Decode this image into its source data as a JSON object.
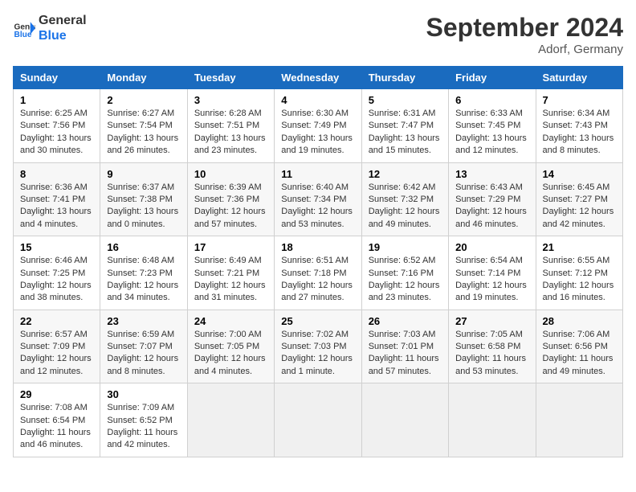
{
  "header": {
    "logo_line1": "General",
    "logo_line2": "Blue",
    "month": "September 2024",
    "location": "Adorf, Germany"
  },
  "weekdays": [
    "Sunday",
    "Monday",
    "Tuesday",
    "Wednesday",
    "Thursday",
    "Friday",
    "Saturday"
  ],
  "weeks": [
    [
      {
        "day": "1",
        "sunrise": "6:25 AM",
        "sunset": "7:56 PM",
        "daylight": "13 hours and 30 minutes."
      },
      {
        "day": "2",
        "sunrise": "6:27 AM",
        "sunset": "7:54 PM",
        "daylight": "13 hours and 26 minutes."
      },
      {
        "day": "3",
        "sunrise": "6:28 AM",
        "sunset": "7:51 PM",
        "daylight": "13 hours and 23 minutes."
      },
      {
        "day": "4",
        "sunrise": "6:30 AM",
        "sunset": "7:49 PM",
        "daylight": "13 hours and 19 minutes."
      },
      {
        "day": "5",
        "sunrise": "6:31 AM",
        "sunset": "7:47 PM",
        "daylight": "13 hours and 15 minutes."
      },
      {
        "day": "6",
        "sunrise": "6:33 AM",
        "sunset": "7:45 PM",
        "daylight": "13 hours and 12 minutes."
      },
      {
        "day": "7",
        "sunrise": "6:34 AM",
        "sunset": "7:43 PM",
        "daylight": "13 hours and 8 minutes."
      }
    ],
    [
      {
        "day": "8",
        "sunrise": "6:36 AM",
        "sunset": "7:41 PM",
        "daylight": "13 hours and 4 minutes."
      },
      {
        "day": "9",
        "sunrise": "6:37 AM",
        "sunset": "7:38 PM",
        "daylight": "13 hours and 0 minutes."
      },
      {
        "day": "10",
        "sunrise": "6:39 AM",
        "sunset": "7:36 PM",
        "daylight": "12 hours and 57 minutes."
      },
      {
        "day": "11",
        "sunrise": "6:40 AM",
        "sunset": "7:34 PM",
        "daylight": "12 hours and 53 minutes."
      },
      {
        "day": "12",
        "sunrise": "6:42 AM",
        "sunset": "7:32 PM",
        "daylight": "12 hours and 49 minutes."
      },
      {
        "day": "13",
        "sunrise": "6:43 AM",
        "sunset": "7:29 PM",
        "daylight": "12 hours and 46 minutes."
      },
      {
        "day": "14",
        "sunrise": "6:45 AM",
        "sunset": "7:27 PM",
        "daylight": "12 hours and 42 minutes."
      }
    ],
    [
      {
        "day": "15",
        "sunrise": "6:46 AM",
        "sunset": "7:25 PM",
        "daylight": "12 hours and 38 minutes."
      },
      {
        "day": "16",
        "sunrise": "6:48 AM",
        "sunset": "7:23 PM",
        "daylight": "12 hours and 34 minutes."
      },
      {
        "day": "17",
        "sunrise": "6:49 AM",
        "sunset": "7:21 PM",
        "daylight": "12 hours and 31 minutes."
      },
      {
        "day": "18",
        "sunrise": "6:51 AM",
        "sunset": "7:18 PM",
        "daylight": "12 hours and 27 minutes."
      },
      {
        "day": "19",
        "sunrise": "6:52 AM",
        "sunset": "7:16 PM",
        "daylight": "12 hours and 23 minutes."
      },
      {
        "day": "20",
        "sunrise": "6:54 AM",
        "sunset": "7:14 PM",
        "daylight": "12 hours and 19 minutes."
      },
      {
        "day": "21",
        "sunrise": "6:55 AM",
        "sunset": "7:12 PM",
        "daylight": "12 hours and 16 minutes."
      }
    ],
    [
      {
        "day": "22",
        "sunrise": "6:57 AM",
        "sunset": "7:09 PM",
        "daylight": "12 hours and 12 minutes."
      },
      {
        "day": "23",
        "sunrise": "6:59 AM",
        "sunset": "7:07 PM",
        "daylight": "12 hours and 8 minutes."
      },
      {
        "day": "24",
        "sunrise": "7:00 AM",
        "sunset": "7:05 PM",
        "daylight": "12 hours and 4 minutes."
      },
      {
        "day": "25",
        "sunrise": "7:02 AM",
        "sunset": "7:03 PM",
        "daylight": "12 hours and 1 minute."
      },
      {
        "day": "26",
        "sunrise": "7:03 AM",
        "sunset": "7:01 PM",
        "daylight": "11 hours and 57 minutes."
      },
      {
        "day": "27",
        "sunrise": "7:05 AM",
        "sunset": "6:58 PM",
        "daylight": "11 hours and 53 minutes."
      },
      {
        "day": "28",
        "sunrise": "7:06 AM",
        "sunset": "6:56 PM",
        "daylight": "11 hours and 49 minutes."
      }
    ],
    [
      {
        "day": "29",
        "sunrise": "7:08 AM",
        "sunset": "6:54 PM",
        "daylight": "11 hours and 46 minutes."
      },
      {
        "day": "30",
        "sunrise": "7:09 AM",
        "sunset": "6:52 PM",
        "daylight": "11 hours and 42 minutes."
      },
      null,
      null,
      null,
      null,
      null
    ]
  ]
}
